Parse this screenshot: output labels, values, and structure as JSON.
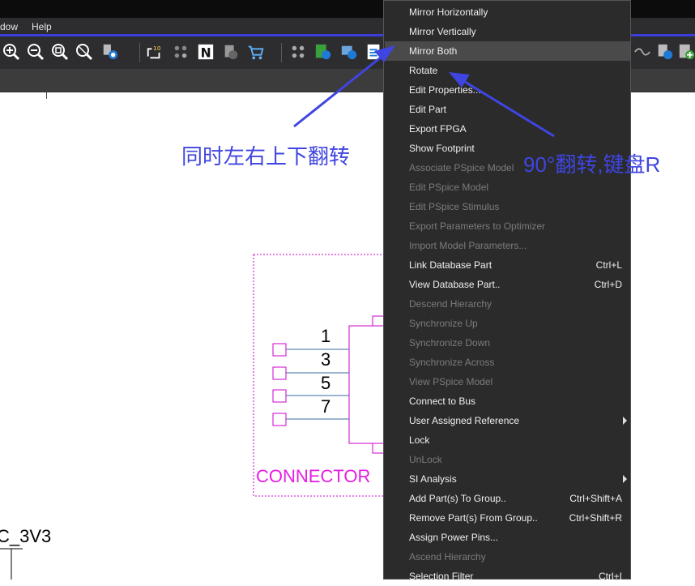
{
  "menubar": {
    "items": [
      "dow",
      "Help"
    ]
  },
  "toolbar": {
    "icons": [
      "zoom-in-icon",
      "zoom-out-icon",
      "zoom-area-icon",
      "zoom-all-icon",
      "place-part-icon",
      "annotate-icon",
      "part-sort-icon",
      "notes-icon",
      "cross-reference-icon",
      "bill-of-materials-icon",
      "drc-icon",
      "netlist-icon",
      "library-update-icon",
      "report-icon",
      "probe-icon",
      "pspice-icon",
      "add-part-icon"
    ]
  },
  "context_menu": {
    "items": [
      {
        "label": "Mirror Horizontally",
        "shortcut": "",
        "enabled": true,
        "submenu": false
      },
      {
        "label": "Mirror Vertically",
        "shortcut": "",
        "enabled": true,
        "submenu": false
      },
      {
        "label": "Mirror Both",
        "shortcut": "",
        "enabled": true,
        "submenu": false,
        "highlighted": true
      },
      {
        "label": "Rotate",
        "shortcut": "",
        "enabled": true,
        "submenu": false
      },
      {
        "label": "Edit Properties...",
        "shortcut": "",
        "enabled": true,
        "submenu": false
      },
      {
        "label": "Edit Part",
        "shortcut": "",
        "enabled": true,
        "submenu": false
      },
      {
        "label": "Export FPGA",
        "shortcut": "",
        "enabled": true,
        "submenu": false
      },
      {
        "label": "Show Footprint",
        "shortcut": "",
        "enabled": true,
        "submenu": false
      },
      {
        "label": "Associate PSpice Model",
        "shortcut": "",
        "enabled": false,
        "submenu": false
      },
      {
        "label": "Edit PSpice Model",
        "shortcut": "",
        "enabled": false,
        "submenu": false
      },
      {
        "label": "Edit PSpice Stimulus",
        "shortcut": "",
        "enabled": false,
        "submenu": false
      },
      {
        "label": "Export Parameters to Optimizer",
        "shortcut": "",
        "enabled": false,
        "submenu": false
      },
      {
        "label": "Import Model Parameters...",
        "shortcut": "",
        "enabled": false,
        "submenu": false
      },
      {
        "label": "Link Database Part",
        "shortcut": "Ctrl+L",
        "enabled": true,
        "submenu": false
      },
      {
        "label": "View Database Part..",
        "shortcut": "Ctrl+D",
        "enabled": true,
        "submenu": false
      },
      {
        "label": "Descend Hierarchy",
        "shortcut": "",
        "enabled": false,
        "submenu": false
      },
      {
        "label": "Synchronize Up",
        "shortcut": "",
        "enabled": false,
        "submenu": false
      },
      {
        "label": "Synchronize Down",
        "shortcut": "",
        "enabled": false,
        "submenu": false
      },
      {
        "label": "Synchronize Across",
        "shortcut": "",
        "enabled": false,
        "submenu": false
      },
      {
        "label": "View PSpice Model",
        "shortcut": "",
        "enabled": false,
        "submenu": false
      },
      {
        "label": "Connect to Bus",
        "shortcut": "",
        "enabled": true,
        "submenu": false
      },
      {
        "label": "User Assigned Reference",
        "shortcut": "",
        "enabled": true,
        "submenu": true
      },
      {
        "label": "Lock",
        "shortcut": "",
        "enabled": true,
        "submenu": false
      },
      {
        "label": "UnLock",
        "shortcut": "",
        "enabled": false,
        "submenu": false
      },
      {
        "label": "SI Analysis",
        "shortcut": "",
        "enabled": true,
        "submenu": true
      },
      {
        "label": "Add Part(s) To Group..",
        "shortcut": "Ctrl+Shift+A",
        "enabled": true,
        "submenu": false
      },
      {
        "label": "Remove Part(s) From Group..",
        "shortcut": "Ctrl+Shift+R",
        "enabled": true,
        "submenu": false
      },
      {
        "label": "Assign Power Pins...",
        "shortcut": "",
        "enabled": true,
        "submenu": false
      },
      {
        "label": "Ascend Hierarchy",
        "shortcut": "",
        "enabled": false,
        "submenu": false
      },
      {
        "label": "Selection Filter",
        "shortcut": "Ctrl+I",
        "enabled": true,
        "submenu": false
      }
    ]
  },
  "annotations": {
    "mirror_both_note": "同时左右上下翻转",
    "rotate_note": "90°翻转,键盘R",
    "color": "#3f45e0"
  },
  "schematic": {
    "pins": [
      "1",
      "3",
      "5",
      "7"
    ],
    "component_label": "CONNECTOR",
    "net_label": "C_3V3",
    "part_color": "#cc00cc",
    "label_color": "#e51ee5"
  }
}
